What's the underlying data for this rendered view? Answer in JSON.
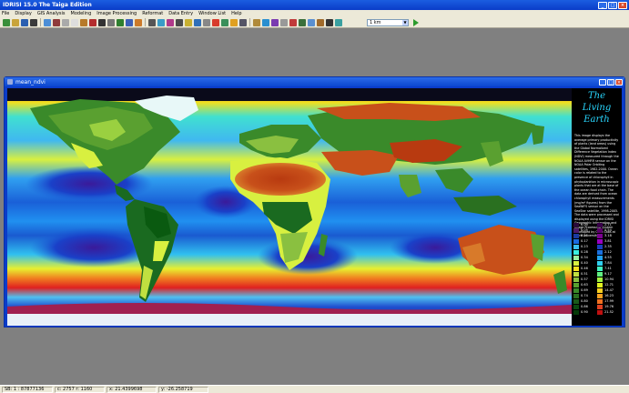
{
  "app": {
    "title": "IDRISI 15.0     The Taiga Edition"
  },
  "menu": [
    "File",
    "Display",
    "GIS Analysis",
    "Modeling",
    "Image Processing",
    "Reformat",
    "Data Entry",
    "Window List",
    "Help"
  ],
  "toolbar": {
    "tool_colors": [
      "#3a8f3a",
      "#c9a43a",
      "#2b5fb0",
      "#3a3a3a",
      "#4c8ed6",
      "#8f3a3a",
      "#aaa",
      "#ddd",
      "#b77a2a",
      "#b42e2e",
      "#333",
      "#777",
      "#2f7f2f",
      "#3c5fb8",
      "#cc7a2a",
      "#555",
      "#3a9cc7",
      "#b03a8a",
      "#4a4a4a",
      "#c8b030",
      "#2f6fb8",
      "#888",
      "#d83c2c",
      "#3a8f5a",
      "#e0a020",
      "#556",
      "#b08a3a",
      "#2a8fd0",
      "#7a3ab0",
      "#999",
      "#c03a3a",
      "#3a6f3a",
      "#5a8fd0",
      "#a06a2a",
      "#333",
      "#3aa0a0"
    ],
    "combo_value": "1 km",
    "combo_arrow": "▼"
  },
  "child_window": {
    "title": "mean_ndvi"
  },
  "panel": {
    "title_lines": [
      "The",
      "Living",
      "Earth"
    ],
    "description": "This image displays the average primary productivity of plants (land areas) using the Global Normalized Difference Vegetation Index (NDVI) measured through the NOAA AVHRR sensor on the NOAA Polar Orbiting satellites, 1982-2000. Ocean color is related to the presence of chlorophyll in phytoplankton in microscopic plants that are at the base of the ocean food chain. The data are derived from ocean chlorophyll measurements (mg/m³ figures) from the SeaWiFS sensor on the SeaStar satellite, 1998-2005. The data were processed and displayed using the IDRISI Geographic Information and Image Processing System developed by Clark Labs at Clark University.",
    "legend_left": {
      "values": [
        "0.00",
        "0.05",
        "0.11",
        "0.17",
        "0.23",
        "0.28",
        "0.34",
        "0.40",
        "0.46",
        "0.51",
        "0.57",
        "0.63",
        "0.69",
        "0.74",
        "0.80",
        "0.86",
        "0.90"
      ],
      "colors": [
        "#2a0a3a",
        "#4a1a6a",
        "#1a3aa0",
        "#1a6ae0",
        "#3ac0f0",
        "#3af0e0",
        "#9af0a0",
        "#d8f040",
        "#f8e020",
        "#c0e040",
        "#8ac040",
        "#5aa030",
        "#3a8a2a",
        "#2a7020",
        "#1a5a1a",
        "#0a4a10",
        "#053a08"
      ]
    },
    "legend_right": {
      "values": [
        "2.71",
        "4.54",
        "3.18",
        "3.81",
        "2.35",
        "2.12",
        "4.55",
        "7.84",
        "7.41",
        "9.17",
        "10.94",
        "12.71",
        "14.47",
        "16.23",
        "17.99",
        "19.76",
        "21.52"
      ],
      "colors": [
        "#3a004a",
        "#5a006a",
        "#7a0090",
        "#9a00c0",
        "#1a40c0",
        "#1a70e0",
        "#20a0f0",
        "#30d0f0",
        "#40f0c0",
        "#60f080",
        "#a0f040",
        "#e0f020",
        "#f8d020",
        "#f8a020",
        "#f07020",
        "#e04020",
        "#c01010"
      ]
    }
  },
  "status": {
    "scale": "SB: 1 : 87877136",
    "col_row": "c: 2757   r: 1160",
    "x": "x: 21.4399698",
    "y": "y: -26.258719"
  }
}
